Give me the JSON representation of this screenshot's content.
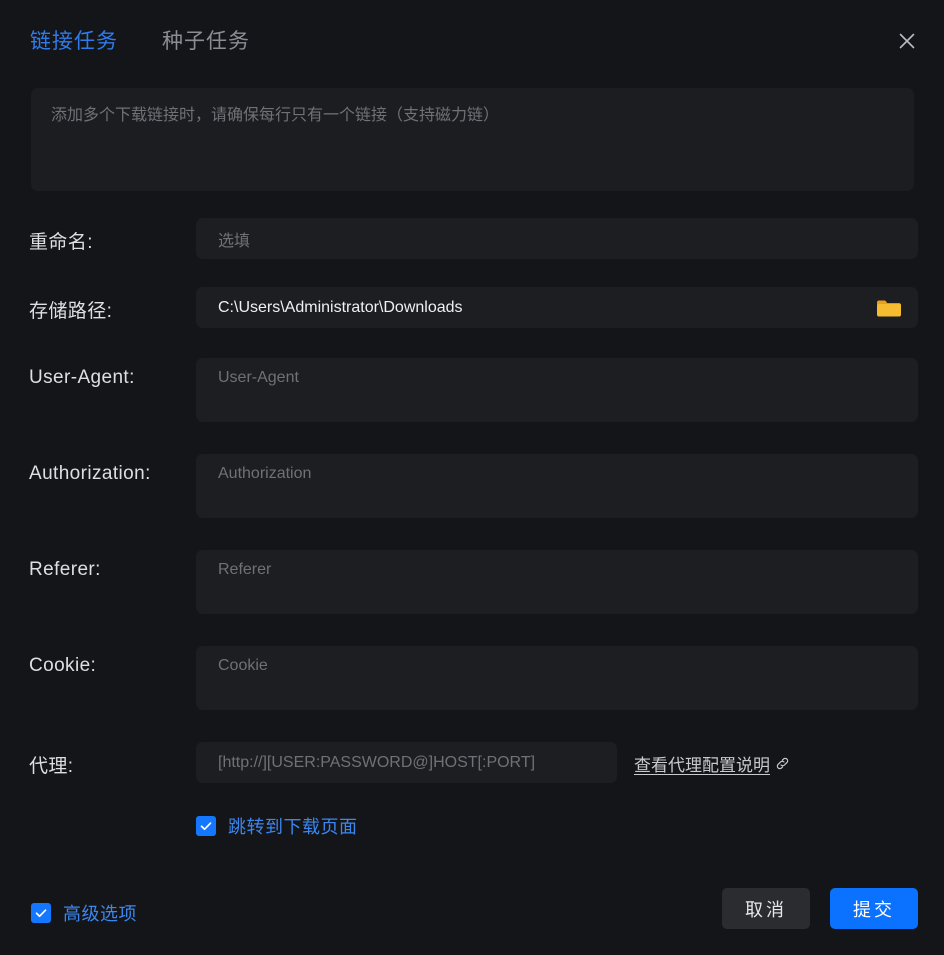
{
  "window": {
    "close_icon": "close-icon"
  },
  "tabs": [
    {
      "label": "链接任务",
      "active": true
    },
    {
      "label": "种子任务",
      "active": false
    }
  ],
  "url_input": {
    "placeholder": "添加多个下载链接时，请确保每行只有一个链接（支持磁力链）",
    "value": ""
  },
  "fields": {
    "rename": {
      "label": "重命名:",
      "placeholder": "选填",
      "value": ""
    },
    "save_path": {
      "label": "存储路径:",
      "value": "C:\\Users\\Administrator\\Downloads",
      "browse_icon": "folder-icon"
    },
    "user_agent": {
      "label": "User-Agent:",
      "placeholder": "User-Agent",
      "value": ""
    },
    "authorization": {
      "label": "Authorization:",
      "placeholder": "Authorization",
      "value": ""
    },
    "referer": {
      "label": "Referer:",
      "placeholder": "Referer",
      "value": ""
    },
    "cookie": {
      "label": "Cookie:",
      "placeholder": "Cookie",
      "value": ""
    },
    "proxy": {
      "label": "代理:",
      "placeholder": "[http://][USER:PASSWORD@]HOST[:PORT]",
      "value": "",
      "help_link": "查看代理配置说明",
      "help_link_icon": "external-link-icon"
    }
  },
  "checkboxes": {
    "jump_to_download": {
      "label": "跳转到下载页面",
      "checked": true
    },
    "advanced_options": {
      "label": "高级选项",
      "checked": true
    }
  },
  "footer": {
    "cancel_label": "取消",
    "submit_label": "提交"
  },
  "colors": {
    "accent": "#0a72ff",
    "tab_active": "#2f7bea",
    "checkbox": "#1477ff",
    "checkbox_label": "#3b86ef",
    "background": "#141518",
    "field_background": "#1d1e21",
    "folder_icon": "#f2b233"
  }
}
